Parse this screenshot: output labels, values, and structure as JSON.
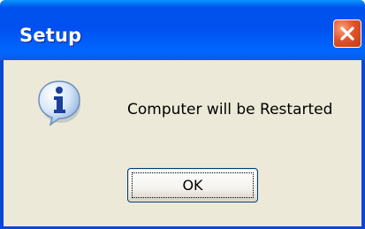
{
  "window": {
    "title": "Setup",
    "close_icon": "close-icon"
  },
  "dialog": {
    "icon": "information-icon",
    "message": "Computer will be Restarted",
    "ok_label": "OK"
  },
  "colors": {
    "titlebar": "#0053ee",
    "client_background": "#ece9d8",
    "close_button": "#e2532b",
    "button_border": "#003c74"
  }
}
